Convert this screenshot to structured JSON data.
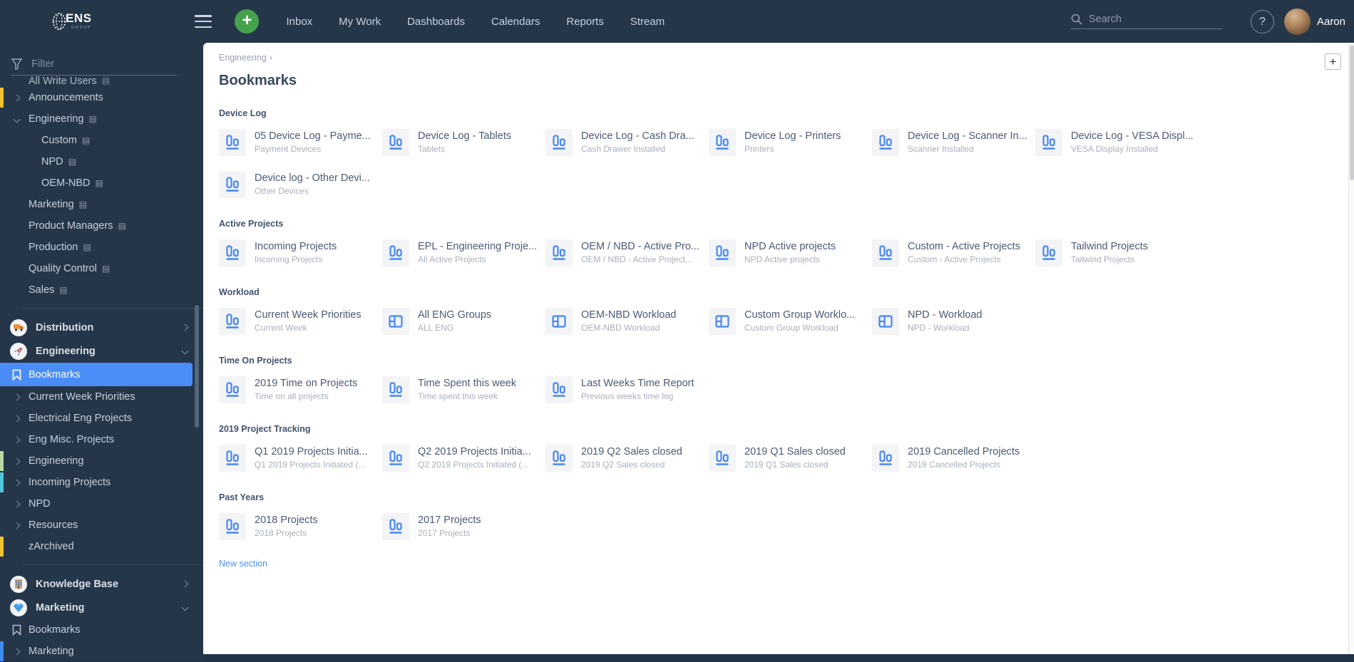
{
  "colors": {
    "dark_bg": "#253649",
    "selected_blue": "#4a8df7",
    "card_icon_blue": "#4787f3",
    "green_plus": "#43a24b",
    "accent_yellow": "#f0c330",
    "accent_green": "#b8d9a0",
    "accent_cyan": "#52c7dc",
    "accent_blue": "#3f8cf3",
    "link_blue": "#4c8ff5"
  },
  "navbar": {
    "logo_text": "ENS",
    "logo_sub": "GROUP",
    "items": [
      {
        "label": "Inbox"
      },
      {
        "label": "My Work"
      },
      {
        "label": "Dashboards"
      },
      {
        "label": "Calendars"
      },
      {
        "label": "Reports"
      },
      {
        "label": "Stream"
      }
    ],
    "search_placeholder": "Search",
    "help_label": "?",
    "user_name": "Aaron",
    "add_label": "+"
  },
  "sidebar": {
    "filter_placeholder": "Filter",
    "tree": [
      {
        "label": "All Write Users",
        "icon": "board-icon"
      },
      {
        "label": "Announcements",
        "accent": "yellow"
      },
      {
        "label": "Engineering",
        "icon": "board-icon",
        "expanded": true
      },
      {
        "label": "Custom",
        "icon": "board-icon"
      },
      {
        "label": "NPD",
        "icon": "board-icon"
      },
      {
        "label": "OEM-NBD",
        "icon": "board-icon"
      },
      {
        "label": "Marketing",
        "icon": "board-icon"
      },
      {
        "label": "Product Managers",
        "icon": "board-icon"
      },
      {
        "label": "Production",
        "icon": "board-icon"
      },
      {
        "label": "Quality Control",
        "icon": "board-icon"
      },
      {
        "label": "Sales",
        "icon": "board-icon"
      }
    ],
    "groups": [
      {
        "label": "Distribution",
        "icon": "truck-icon",
        "state": "collapsed"
      },
      {
        "label": "Engineering",
        "icon": "rocket-icon",
        "state": "expanded"
      },
      {
        "label": "Knowledge Base",
        "icon": "building-icon",
        "state": "collapsed"
      },
      {
        "label": "Marketing",
        "icon": "gem-icon",
        "state": "expanded"
      }
    ],
    "engineering_children": [
      {
        "label": "Bookmarks",
        "icon": "bookmark-icon",
        "selected": true
      },
      {
        "label": "Current Week Priorities"
      },
      {
        "label": "Electrical Eng Projects"
      },
      {
        "label": "Eng Misc. Projects"
      },
      {
        "label": "Engineering",
        "accent": "green"
      },
      {
        "label": "Incoming Projects",
        "accent": "cyan"
      },
      {
        "label": "NPD"
      },
      {
        "label": "Resources"
      },
      {
        "label": "zArchived",
        "accent": "yellow"
      }
    ],
    "marketing_children": [
      {
        "label": "Bookmarks",
        "icon": "bookmark-icon"
      },
      {
        "label": "Marketing",
        "accent": "blue"
      }
    ]
  },
  "main": {
    "breadcrumb": "Engineering",
    "breadcrumb_sep": "›",
    "title": "Bookmarks",
    "add_button": "+",
    "new_section_label": "New section",
    "sections": [
      {
        "name": "Device Log",
        "cards": [
          {
            "title": "05 Device Log - Payme...",
            "subtitle": "Payment Devices",
            "icon": "views-icon"
          },
          {
            "title": "Device Log - Tablets",
            "subtitle": "Tablets",
            "icon": "views-icon"
          },
          {
            "title": "Device Log - Cash Dra...",
            "subtitle": "Cash Drawer Installed",
            "icon": "views-icon"
          },
          {
            "title": "Device Log - Printers",
            "subtitle": "Printers",
            "icon": "views-icon"
          },
          {
            "title": "Device Log - Scanner In...",
            "subtitle": "Scanner Installed",
            "icon": "views-icon"
          },
          {
            "title": "Device Log - VESA Displ...",
            "subtitle": "VESA Display Installed",
            "icon": "views-icon"
          },
          {
            "title": "Device log - Other Devi...",
            "subtitle": "Other Devices",
            "icon": "views-icon"
          }
        ]
      },
      {
        "name": "Active Projects",
        "cards": [
          {
            "title": "Incoming Projects",
            "subtitle": "Incoming Projects",
            "icon": "views-icon"
          },
          {
            "title": "EPL - Engineering Proje...",
            "subtitle": "All Active Projects",
            "icon": "views-icon"
          },
          {
            "title": "OEM / NBD - Active Pro...",
            "subtitle": "OEM / NBD - Active Project...",
            "icon": "views-icon"
          },
          {
            "title": "NPD Active projects",
            "subtitle": "NPD Active projects",
            "icon": "views-icon"
          },
          {
            "title": "Custom - Active Projects",
            "subtitle": "Custom - Active Projects",
            "icon": "views-icon"
          },
          {
            "title": "Tailwind Projects",
            "subtitle": "Tailwind Projects",
            "icon": "views-icon"
          }
        ]
      },
      {
        "name": "Workload",
        "cards": [
          {
            "title": "Current Week Priorities",
            "subtitle": "Current Week",
            "icon": "views-icon"
          },
          {
            "title": "All ENG Groups",
            "subtitle": "ALL ENG",
            "icon": "board-icon"
          },
          {
            "title": "OEM-NBD Workload",
            "subtitle": "OEM-NBD Workload",
            "icon": "board-icon"
          },
          {
            "title": "Custom Group Worklo...",
            "subtitle": "Custom Group Workload",
            "icon": "board-icon"
          },
          {
            "title": "NPD - Workload",
            "subtitle": "NPD - Workload",
            "icon": "board-icon"
          }
        ]
      },
      {
        "name": "Time On Projects",
        "cards": [
          {
            "title": "2019 Time on Projects",
            "subtitle": "Time on all projects",
            "icon": "views-icon"
          },
          {
            "title": "Time Spent this week",
            "subtitle": "Time spent this week",
            "icon": "views-icon"
          },
          {
            "title": "Last Weeks Time Report",
            "subtitle": "Previous weeks time log",
            "icon": "views-icon"
          }
        ]
      },
      {
        "name": "2019 Project Tracking",
        "cards": [
          {
            "title": "Q1 2019 Projects Initia...",
            "subtitle": "Q1 2019 Projects Initiated (...",
            "icon": "views-icon"
          },
          {
            "title": "Q2 2019 Projects Initia...",
            "subtitle": "Q2 2019 Projects Initiated (...",
            "icon": "views-icon"
          },
          {
            "title": "2019 Q2 Sales closed",
            "subtitle": "2019 Q2 Sales closed",
            "icon": "views-icon"
          },
          {
            "title": "2019 Q1 Sales closed",
            "subtitle": "2019 Q1 Sales closed",
            "icon": "views-icon"
          },
          {
            "title": "2019 Cancelled Projects",
            "subtitle": "2019 Cancelled Projects",
            "icon": "views-icon"
          }
        ]
      },
      {
        "name": "Past Years",
        "cards": [
          {
            "title": "2018 Projects",
            "subtitle": "2018 Projects",
            "icon": "views-icon"
          },
          {
            "title": "2017 Projects",
            "subtitle": "2017 Projects",
            "icon": "views-icon"
          }
        ]
      }
    ]
  }
}
